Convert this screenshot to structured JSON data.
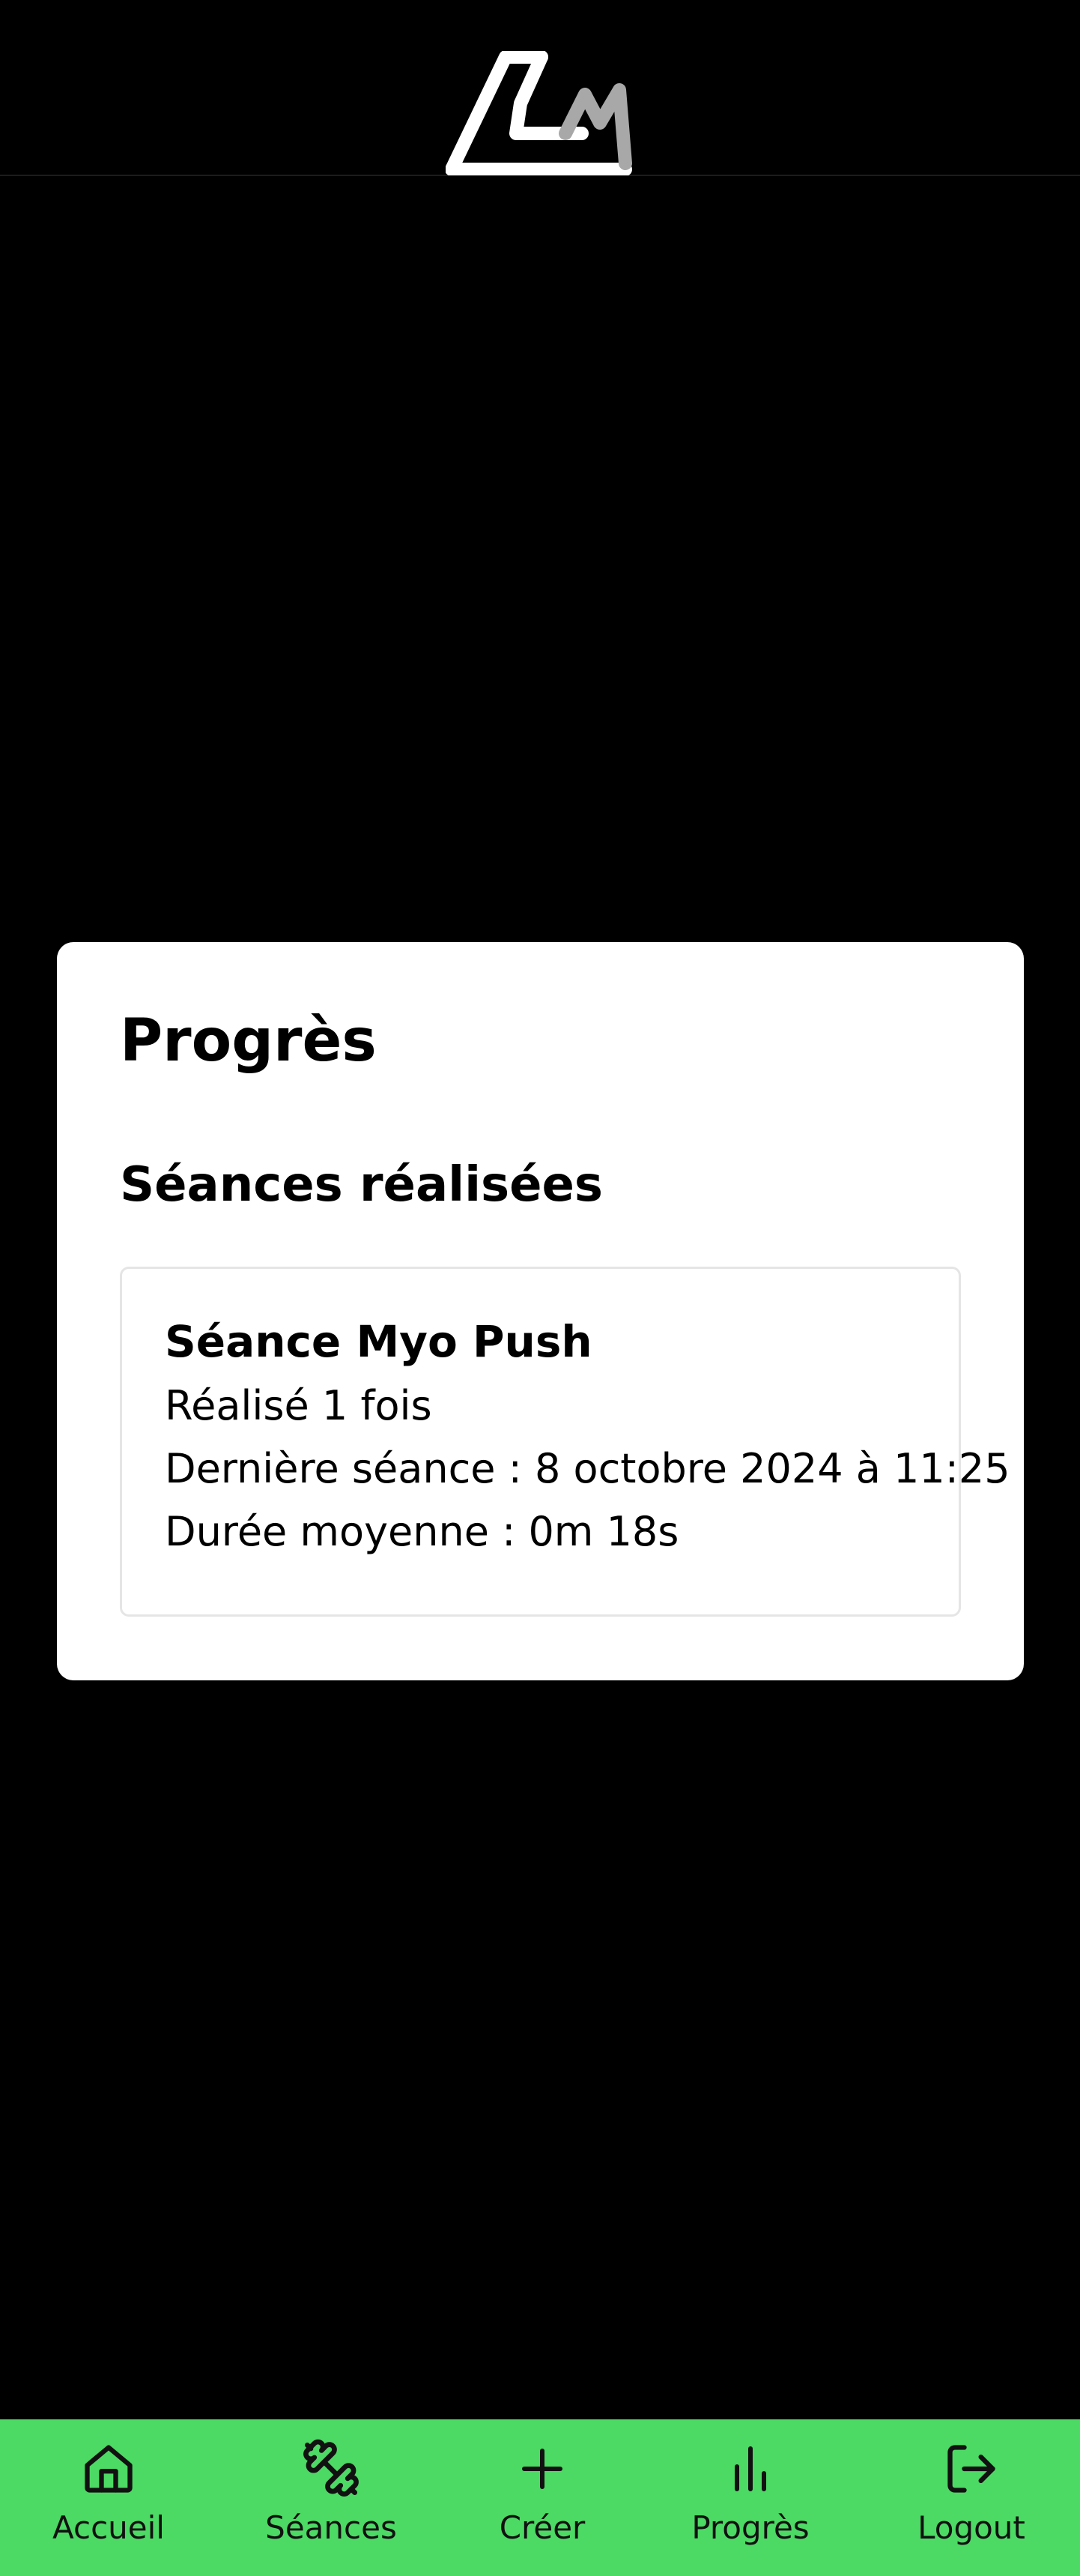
{
  "header": {
    "logo_icon": "cm-logo-icon"
  },
  "card": {
    "title": "Progrès",
    "subtitle": "Séances réalisées",
    "sessions": [
      {
        "name": "Séance Myo Push",
        "count": "Réalisé 1 fois",
        "last": "Dernière séance : 8 octobre 2024 à 11:25",
        "duration": "Durée moyenne : 0m 18s"
      }
    ]
  },
  "nav": {
    "items": [
      {
        "label": "Accueil",
        "icon": "home-icon"
      },
      {
        "label": "Séances",
        "icon": "dumbbell-icon"
      },
      {
        "label": "Créer",
        "icon": "plus-icon"
      },
      {
        "label": "Progrès",
        "icon": "bar-chart-icon"
      },
      {
        "label": "Logout",
        "icon": "logout-icon"
      }
    ]
  },
  "colors": {
    "background": "#000000",
    "card": "#ffffff",
    "nav": "#4cd964"
  }
}
